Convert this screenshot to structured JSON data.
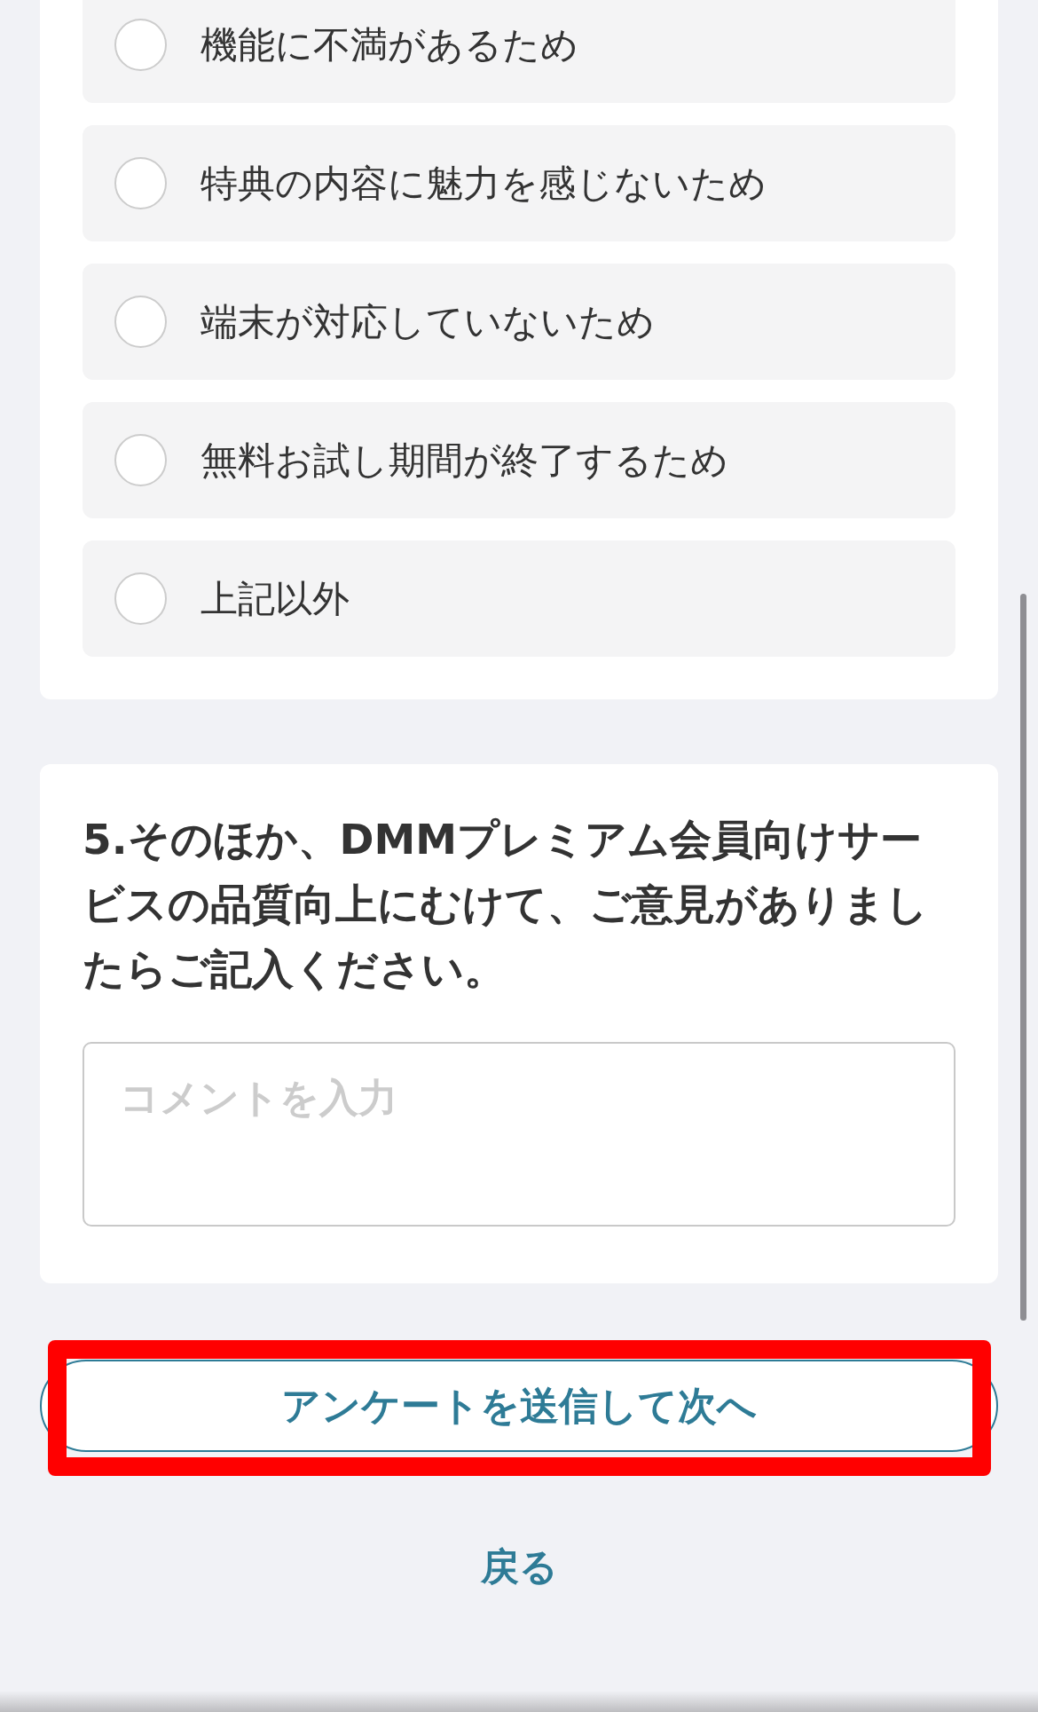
{
  "reason_card": {
    "options": [
      {
        "label": "機能に不満があるため",
        "selected": false
      },
      {
        "label": "特典の内容に魅力を感じないため",
        "selected": false
      },
      {
        "label": "端末が対応していないため",
        "selected": false
      },
      {
        "label": "無料お試し期間が終了するため",
        "selected": false
      },
      {
        "label": "上記以外",
        "selected": false
      }
    ]
  },
  "comment_card": {
    "question": "5.そのほか、DMMプレミアム会員向けサービスの品質向上にむけて、ご意見がありましたらご記入ください。",
    "comment_field": {
      "placeholder": "コメントを入力"
    }
  },
  "submit_button": {
    "label": "アンケートを送信して次へ",
    "highlighted": true
  },
  "back_link": {
    "label": "戻る"
  }
}
